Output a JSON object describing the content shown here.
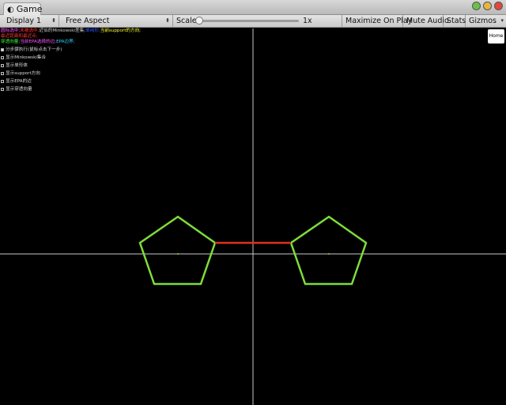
{
  "window": {
    "tab_title": "Game",
    "tab_icon": "game-icon"
  },
  "toolbar": {
    "display": "Display 1",
    "aspect": "Free Aspect",
    "scale_label": "Scale",
    "scale_value": "1x",
    "maximize": "Maximize On Play",
    "mute": "Mute Audio",
    "stats": "Stats",
    "gizmos": "Gizmos"
  },
  "legend": {
    "line1": [
      {
        "text": "圆标选中;",
        "color": "#ff55ff"
      },
      {
        "text": "未被选中;",
        "color": "#ff3333"
      },
      {
        "text": "近似的Minkowski差集;",
        "color": "#cccccc"
      },
      {
        "text": "单纯形;",
        "color": "#3355ff"
      },
      {
        "text": "当前support的方向;",
        "color": "#ffff33"
      }
    ],
    "line2": [
      {
        "text": "最近距离和最近点;",
        "color": "#ff3333"
      }
    ],
    "line3": [
      {
        "text": "穿透向量;",
        "color": "#33ff33"
      },
      {
        "text": "当前EPA选择的边;",
        "color": "#ff55ff"
      },
      {
        "text": "EPA边界;",
        "color": "#33ccff"
      }
    ]
  },
  "options": [
    {
      "label": "分步骤执行(鼠标点击下一步)",
      "checked": true
    },
    {
      "label": "显示Minkowski集合",
      "checked": false
    },
    {
      "label": "显示单形体",
      "checked": false
    },
    {
      "label": "显示support方向",
      "checked": false
    },
    {
      "label": "显示EPA的边",
      "checked": false
    },
    {
      "label": "显示穿透向量",
      "checked": false
    }
  ],
  "home_button": "Home",
  "colors": {
    "shape_outline": "#7ddc3a",
    "distance_line": "#e0321e",
    "axes": "#c8c8c8",
    "background": "#000000"
  }
}
